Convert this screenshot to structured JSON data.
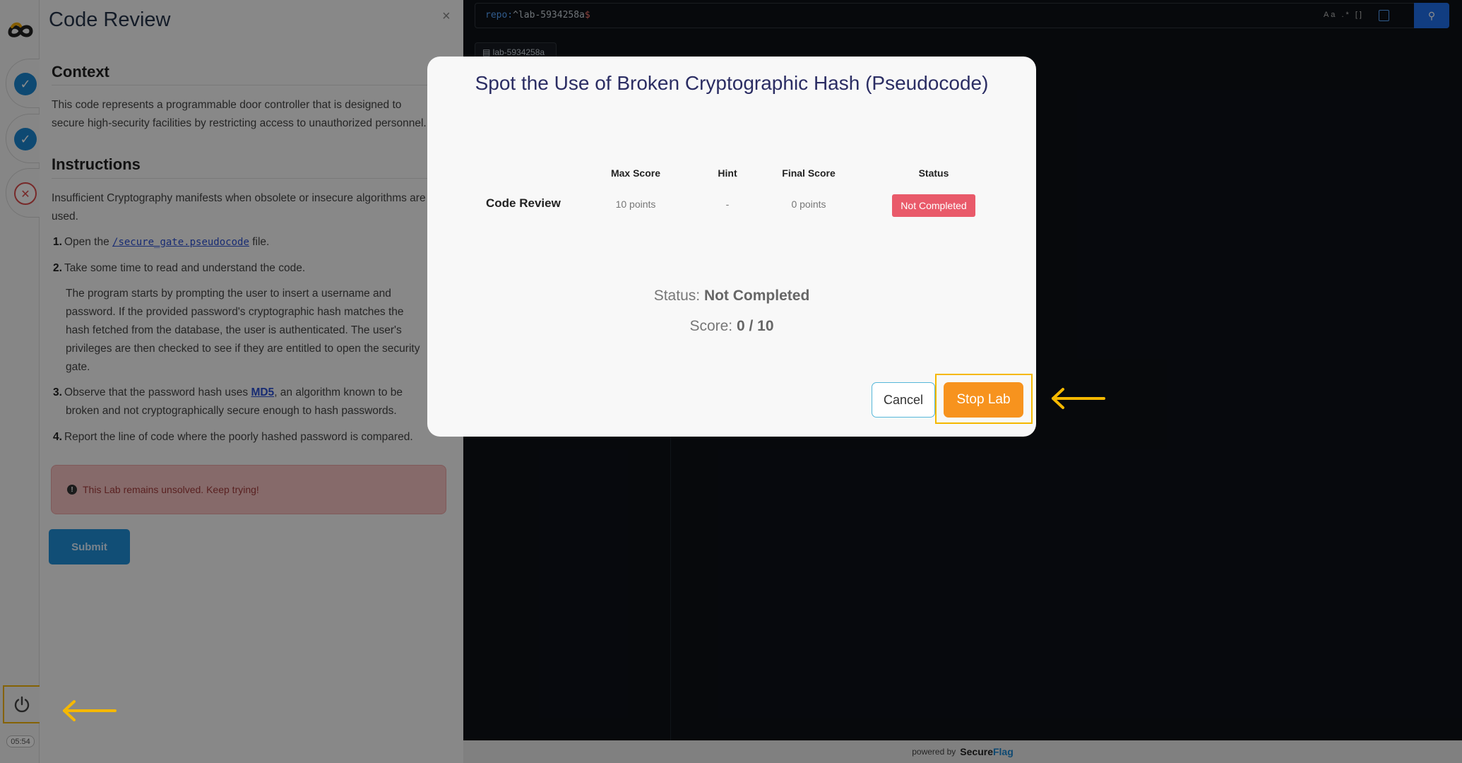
{
  "panel": {
    "title": "Code Review",
    "close": "×",
    "context_heading": "Context",
    "context_lines": [
      "This code represents a programmable door controller that is designed to",
      "secure high-security facilities by restricting access to unauthorized personnel."
    ],
    "instructions_heading": "Instructions",
    "intro_lines": [
      "Insufficient Cryptography manifests when obsolete or insecure algorithms are",
      "used."
    ],
    "step1": {
      "num": "1.",
      "pre": "Open the ",
      "link": "/secure_gate.pseudocode",
      "post": " file."
    },
    "step2": {
      "num": "2.",
      "text": "Take some time to read and understand the code."
    },
    "step2_detail": [
      "The program starts by prompting the user to insert a username and",
      "password. If the provided password's cryptographic hash matches the",
      "hash fetched from the database, the user is authenticated. The user's",
      "privileges are then checked to see if they are entitled to open the security",
      "gate."
    ],
    "step3": {
      "num": "3.",
      "pre": "Observe that the password hash uses ",
      "link": "MD5",
      "post": ", an algorithm known to be",
      "line2": "broken and not cryptographically secure enough to hash passwords."
    },
    "step4": {
      "num": "4.",
      "text": "Report the line of code where the poorly hashed password is compared."
    },
    "alert_text": "This Lab remains unsolved. Keep trying!",
    "submit_label": "Submit"
  },
  "rail": {
    "steps": [
      {
        "status": "done",
        "icon": "check-icon",
        "glyph": "✓"
      },
      {
        "status": "done",
        "icon": "check-icon",
        "glyph": "✓"
      },
      {
        "status": "failed",
        "icon": "x-icon",
        "glyph": "✕"
      }
    ],
    "timer": "05:54"
  },
  "code_view": {
    "query_key": "repo:",
    "query_value": "^lab-5934258a",
    "query_end": "$",
    "tools": "Aa .* []",
    "repo_tab": "lab-5934258a"
  },
  "footer": {
    "powered_by": "powered by",
    "brand_a": "Secure",
    "brand_b": "Flag"
  },
  "modal": {
    "title": "Spot the Use of Broken Cryptographic Hash (Pseudocode)",
    "headers": [
      "Max Score",
      "Hint",
      "Final Score",
      "Status"
    ],
    "row": {
      "label": "Code Review",
      "max_score": "10 points",
      "hint": "-",
      "final_score": "0 points",
      "status": "Not Completed"
    },
    "status_label": "Status:",
    "status_value": "Not Completed",
    "score_label": "Score:",
    "score_value": "0 / 10",
    "cancel_label": "Cancel",
    "stop_label": "Stop Lab"
  },
  "colors": {
    "accent_orange": "#f7931e",
    "highlight_yellow": "#f5b800",
    "status_red": "#e95a6a",
    "check_blue": "#1a86d0"
  }
}
